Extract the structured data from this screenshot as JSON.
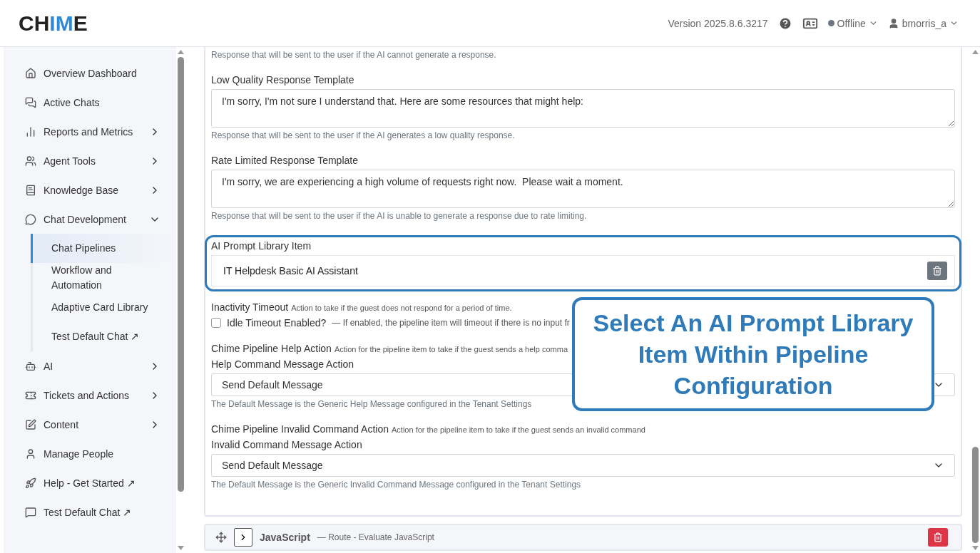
{
  "header": {
    "logo_dark": "CH",
    "logo_accent": "IM",
    "logo_end": "E",
    "version": "Version 2025.8.6.3217",
    "status": "Offline",
    "user": "bmorris_a"
  },
  "sidebar": {
    "items": [
      {
        "label": "Overview Dashboard"
      },
      {
        "label": "Active Chats"
      },
      {
        "label": "Reports and Metrics",
        "expanded": false
      },
      {
        "label": "Agent Tools",
        "expanded": false
      },
      {
        "label": "Knowledge Base",
        "expanded": false
      },
      {
        "label": "Chat Development",
        "expanded": true,
        "children": [
          {
            "label": "Chat Pipelines",
            "selected": true
          },
          {
            "label": "Workflow and Automation",
            "selected": false
          },
          {
            "label": "Adaptive Card Library",
            "selected": false
          },
          {
            "label": "Test Default Chat ↗",
            "selected": false
          }
        ]
      },
      {
        "label": "AI",
        "expanded": false
      },
      {
        "label": "Tickets and Actions",
        "expanded": false
      },
      {
        "label": "Content",
        "expanded": false
      },
      {
        "label": "Manage People"
      },
      {
        "label": "Help - Get Started ↗"
      },
      {
        "label": "Test Default Chat ↗"
      }
    ]
  },
  "form": {
    "top_hint": "Response that will be sent to the user if the AI cannot generate a response.",
    "fields": [
      {
        "kind": "textarea",
        "label": "Low Quality Response Template",
        "value": "I'm sorry, I'm not sure I understand that. Here are some resources that might help:",
        "hint": "Response that will be sent to the user if the AI generates a low quality response."
      },
      {
        "kind": "textarea",
        "label": "Rate Limited Response Template",
        "value": "I'm sorry, we are experiencing a high volume of requests right now.  Please wait a moment.",
        "hint": "Response that will be sent to the user if the AI is unable to generate a response due to rate limiting."
      },
      {
        "kind": "library",
        "label": "AI Prompt Library Item",
        "value": "IT Helpdesk Basic AI Assistant",
        "highlighted": true
      },
      {
        "kind": "checkbox",
        "title": "Inactivity Timeout",
        "description": "Action to take if the guest does not respond for a period of time.",
        "label": "Idle Timeout Enabled?",
        "detail": "— If enabled, the pipeline item will timeout if there is no input fr",
        "checked": false
      },
      {
        "kind": "select",
        "title": "Chime Pipeline Help Action",
        "description": "Action for the pipeline item to take if the guest sends a help comma",
        "label": "Help Command Message Action",
        "value": "Send Default Message",
        "hint": "The Default Message is the Generic Help Message configured in the Tenant Settings"
      },
      {
        "kind": "select",
        "title": "Chime Pipeline Invalid Command Action",
        "description": "Action for the pipeline item to take if the guest sends an invalid command",
        "label": "Invalid Command Message Action",
        "value": "Send Default Message",
        "hint": "The Default Message is the Generic Invalid Command Message configured in the Tenant Settings"
      }
    ]
  },
  "pipeline_items": [
    {
      "name": "JavaScript",
      "description": "— Route - Evaluate JavaScript"
    }
  ],
  "callout": {
    "text": "Select An AI Prompt Library Item Within Pipeline Configuration"
  }
}
